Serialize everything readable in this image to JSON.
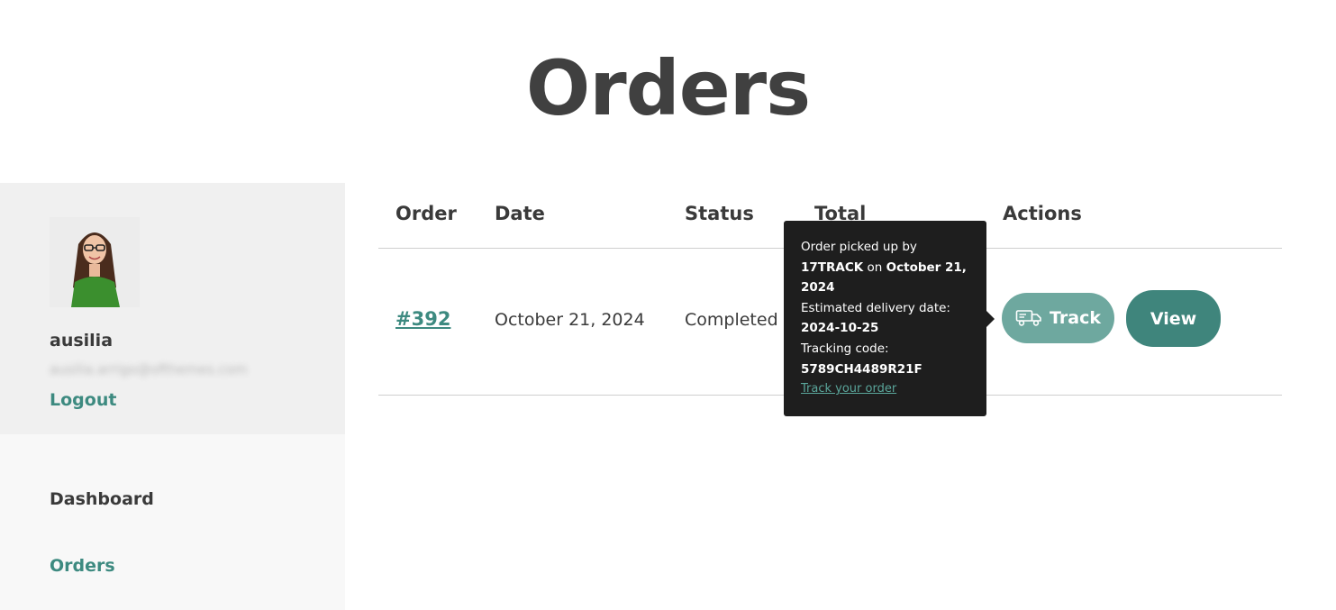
{
  "page": {
    "title": "Orders"
  },
  "account": {
    "username": "ausilia",
    "email": "ausilia.arrigo@ofthemes.com",
    "logout_label": "Logout"
  },
  "nav": {
    "items": [
      {
        "label": "Dashboard",
        "active": false
      },
      {
        "label": "Orders",
        "active": true
      }
    ]
  },
  "table": {
    "headers": [
      "Order",
      "Date",
      "Status",
      "Total",
      "Actions"
    ],
    "rows": [
      {
        "order": "#392",
        "date": "October 21, 2024",
        "status": "Completed",
        "actions": {
          "track_label": "Track",
          "view_label": "View"
        }
      }
    ]
  },
  "tooltip": {
    "line1": "Order picked up by",
    "carrier": "17TRACK",
    "on_word": "on",
    "pickup_date": "October 21,",
    "pickup_year": "2024",
    "delivery_label": "Estimated delivery date:",
    "delivery_date": "2024-10-25",
    "tracking_label": "Tracking code:",
    "tracking_code": "5789CH4489R21F",
    "track_link": "Track your order"
  },
  "colors": {
    "accent": "#3d8a80",
    "track_button": "#6ea89f",
    "view_button": "#3f857c",
    "tooltip_bg": "#1e1e1e"
  },
  "icons": {
    "track": "truck-icon"
  }
}
